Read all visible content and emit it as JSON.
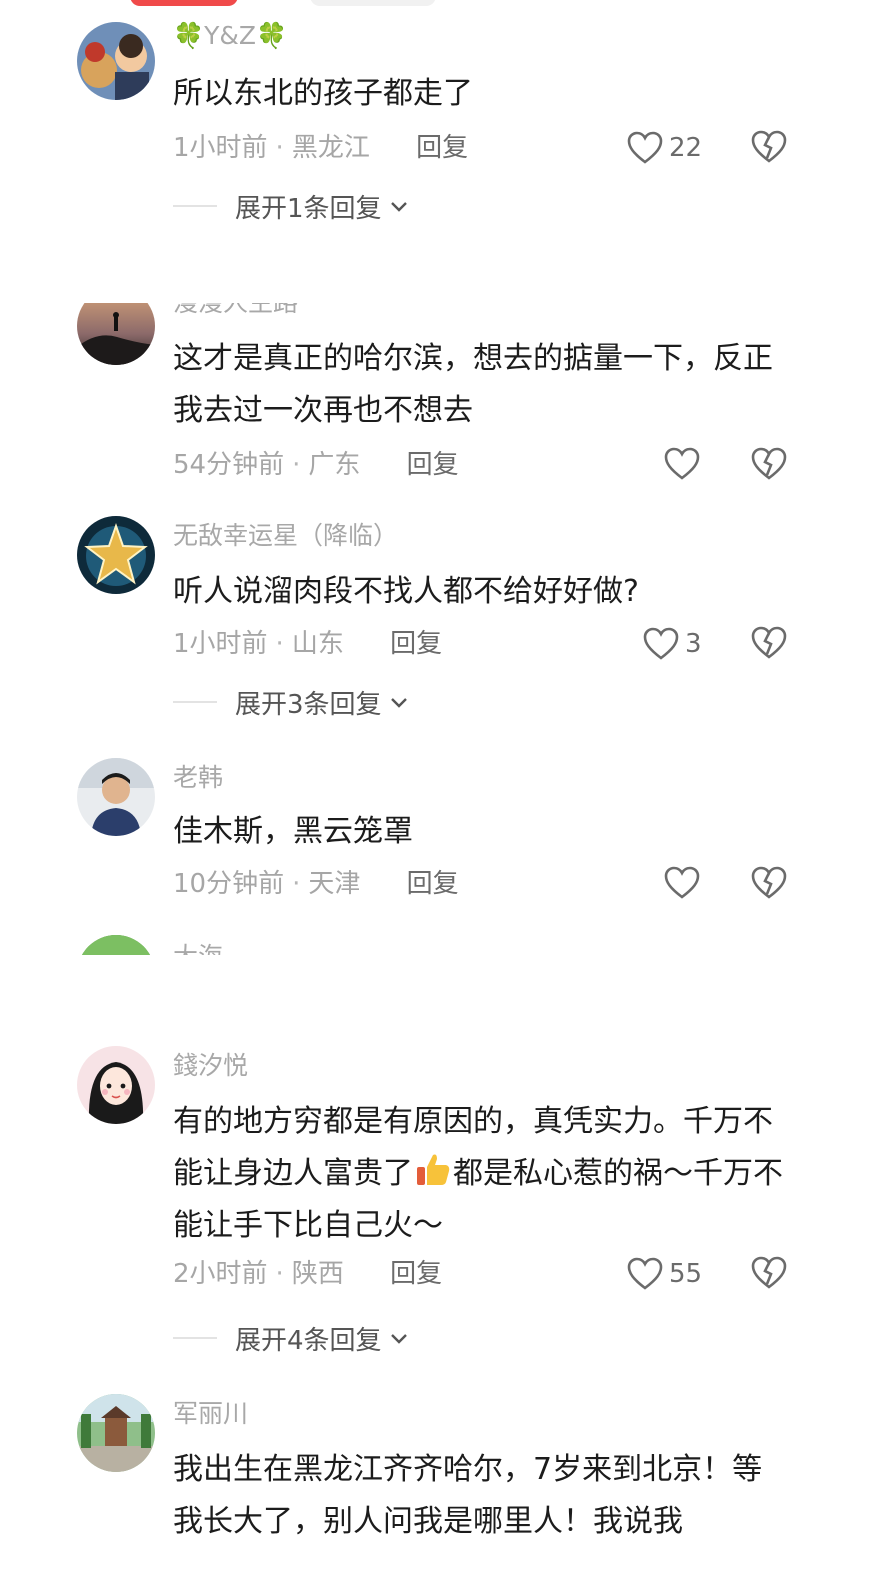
{
  "comments": [
    {
      "username": "🍀Y&Z🍀",
      "text": "所以东北的孩子都走了",
      "time": "1小时前",
      "location": "黑龙江",
      "reply_label": "回复",
      "likes": "22",
      "expand": "展开1条回复"
    },
    {
      "username": "漫漫人生路",
      "text": "这才是真正的哈尔滨，想去的掂量一下，反正我去过一次再也不想去",
      "time": "54分钟前",
      "location": "广东",
      "reply_label": "回复",
      "likes": ""
    },
    {
      "username": "无敌幸运星（降临）",
      "text": "听人说溜肉段不找人都不给好好做?",
      "time": "1小时前",
      "location": "山东",
      "reply_label": "回复",
      "likes": "3",
      "expand": "展开3条回复"
    },
    {
      "username": "老韩",
      "text": "佳木斯，黑云笼罩",
      "time": "10分钟前",
      "location": "天津",
      "reply_label": "回复",
      "likes": ""
    },
    {
      "username": "大海"
    },
    {
      "username": "錢汐悦",
      "text_part1": "有的地方穷都是有原因的，真凭实力。千万不能让身边人富贵了",
      "text_part2": "都是私心惹的祸～千万不能让手下比自己火～",
      "time": "2小时前",
      "location": "陕西",
      "reply_label": "回复",
      "likes": "55",
      "expand": "展开4条回复"
    },
    {
      "username": "军丽川",
      "text": "我出生在黑龙江齐齐哈尔，7岁来到北京！等我长大了，别人问我是哪里人！我说我"
    }
  ],
  "icons": {
    "like": "heart-outline-icon",
    "dislike": "broken-heart-icon",
    "expand": "chevron-down-icon",
    "emoji": "thumbs-up-icon"
  },
  "colors": {
    "text": "#1c1c1c",
    "meta": "#a6a6a6",
    "accent_pill": "#f04a4a"
  }
}
